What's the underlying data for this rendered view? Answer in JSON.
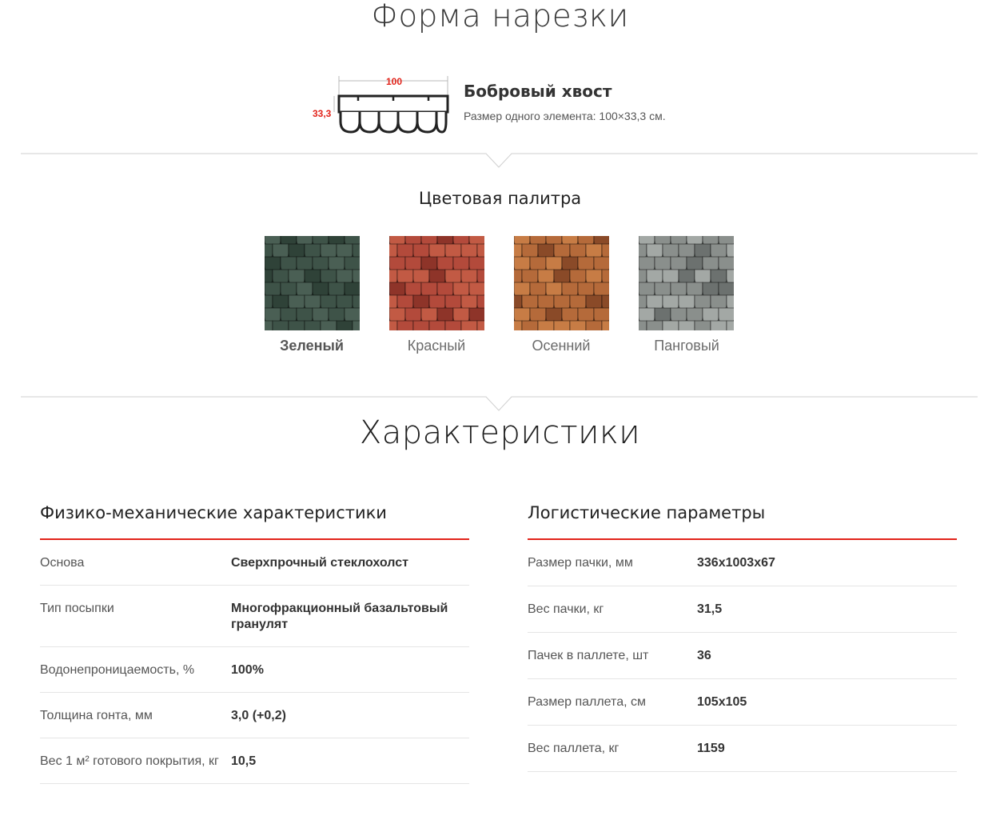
{
  "cut_section": {
    "title": "Форма нарезки",
    "shape": {
      "width_label": "100",
      "height_label": "33,3",
      "name": "Бобровый хвост",
      "size_text": "Размер одного элемента: 100×33,3 см."
    }
  },
  "palette": {
    "title": "Цветовая палитра",
    "items": [
      {
        "label": "Зеленый",
        "selected": true,
        "colors": [
          "#3e5348",
          "#4a5f54",
          "#2f4238"
        ]
      },
      {
        "label": "Красный",
        "selected": false,
        "colors": [
          "#b34a3b",
          "#c25a44",
          "#8e3429"
        ]
      },
      {
        "label": "Осенний",
        "selected": false,
        "colors": [
          "#b56a3a",
          "#c77c45",
          "#8a4a28"
        ]
      },
      {
        "label": "Панговый",
        "selected": false,
        "colors": [
          "#8a8f8c",
          "#a3a8a5",
          "#6c716f"
        ]
      }
    ]
  },
  "characteristics": {
    "title": "Характеристики",
    "physical": {
      "title": "Физико-механические характеристики",
      "rows": [
        {
          "key": "Основа",
          "value": "Сверхпрочный стеклохолст"
        },
        {
          "key": "Тип посыпки",
          "value": "Многофракционный базальтовый гранулят"
        },
        {
          "key": "Водонепроницаемость, %",
          "value": "100%"
        },
        {
          "key": "Толщина гонта, мм",
          "value": "3,0 (+0,2)"
        },
        {
          "key": "Вес 1 м² готового покрытия, кг",
          "value": "10,5"
        }
      ]
    },
    "logistics": {
      "title": "Логистические параметры",
      "rows": [
        {
          "key": "Размер пачки, мм",
          "value": "336x1003x67"
        },
        {
          "key": "Вес пачки, кг",
          "value": "31,5"
        },
        {
          "key": "Пачек в паллете, шт",
          "value": "36"
        },
        {
          "key": "Размер паллета, см",
          "value": "105x105"
        },
        {
          "key": "Вес паллета, кг",
          "value": "1159"
        }
      ]
    }
  },
  "colors": {
    "accent": "#e2231a",
    "dimension_label": "#e2231a"
  }
}
